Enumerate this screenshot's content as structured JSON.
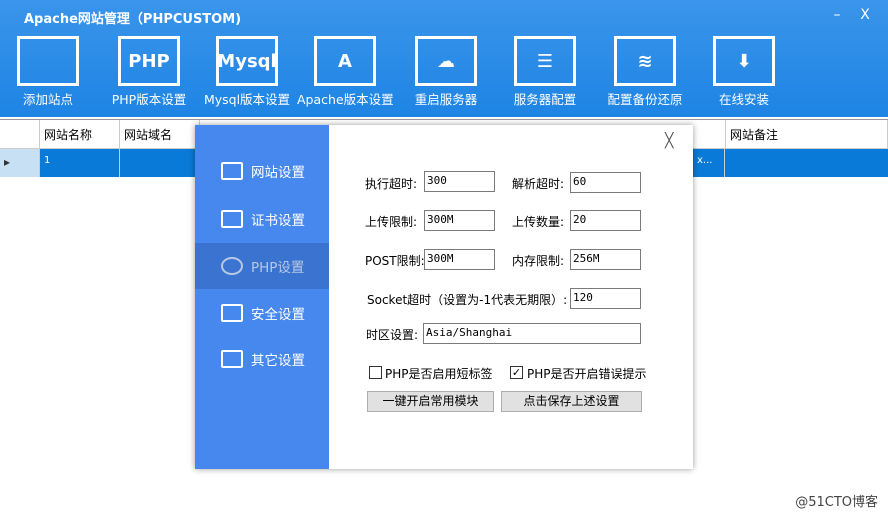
{
  "window": {
    "title": "Apache网站管理（PHPCUSTOM)",
    "minimize": "–",
    "close": "X"
  },
  "toolbar": [
    {
      "label": "添加站点",
      "icon": "monitor-icon",
      "glyph": ""
    },
    {
      "label": "PHP版本设置",
      "icon": "php-icon",
      "glyph": "PHP"
    },
    {
      "label": "Mysql版本设置",
      "icon": "mysql-icon",
      "glyph": "Mysql"
    },
    {
      "label": "Apache版本设置",
      "icon": "apache-icon",
      "glyph": "A"
    },
    {
      "label": "重启服务器",
      "icon": "cloud-restart-icon",
      "glyph": "☁"
    },
    {
      "label": "服务器配置",
      "icon": "sliders-icon",
      "glyph": "☰"
    },
    {
      "label": "配置备份还原",
      "icon": "layers-icon",
      "glyph": "≋"
    },
    {
      "label": "在线安装",
      "icon": "download-cloud-icon",
      "glyph": "⬇"
    }
  ],
  "table": {
    "columns": [
      "网站名称",
      "网站域名",
      "网站备注"
    ],
    "row": {
      "marker": "▸",
      "name": "1",
      "truncated": "x..."
    }
  },
  "dialog": {
    "close": "╳",
    "nav": [
      {
        "label": "网站设置"
      },
      {
        "label": "证书设置"
      },
      {
        "label": "PHP设置"
      },
      {
        "label": "安全设置"
      },
      {
        "label": "其它设置"
      }
    ],
    "fields": {
      "exec_timeout": {
        "label": "执行超时:",
        "value": "300"
      },
      "parse_timeout": {
        "label": "解析超时:",
        "value": "60"
      },
      "upload_limit": {
        "label": "上传限制:",
        "value": "300M"
      },
      "upload_count": {
        "label": "上传数量:",
        "value": "20"
      },
      "post_limit": {
        "label": "POST限制:",
        "value": "300M"
      },
      "memory_limit": {
        "label": "内存限制:",
        "value": "256M"
      },
      "socket_timeout": {
        "label": "Socket超时（设置为-1代表无期限）:",
        "value": "120"
      },
      "timezone": {
        "label": "时区设置:",
        "value": "Asia/Shanghai"
      }
    },
    "short_tag": {
      "label": "PHP是否启用短标签",
      "checked": false
    },
    "display_errors": {
      "label": "PHP是否开启错误提示",
      "checked": true
    },
    "enable_modules": "一键开启常用模块",
    "save": "点击保存上述设置"
  },
  "watermark": "@51CTO博客"
}
